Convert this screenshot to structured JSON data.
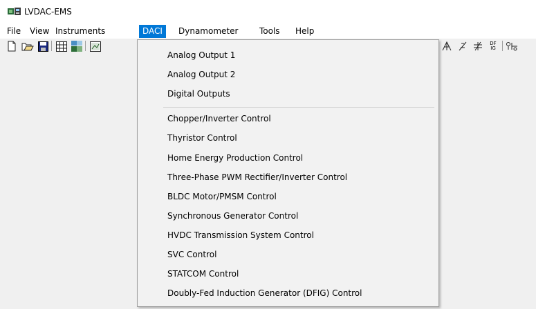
{
  "window": {
    "title": "LVDAC-EMS"
  },
  "menubar": {
    "items": [
      {
        "label": "File"
      },
      {
        "label": "View"
      },
      {
        "label": "Instruments"
      },
      {
        "label": "DACI"
      },
      {
        "label": "Dynamometer"
      },
      {
        "label": "Tools"
      },
      {
        "label": "Help"
      }
    ]
  },
  "toolbar": {
    "icons": [
      "new-file-icon",
      "open-folder-icon",
      "save-icon",
      "table-icon",
      "metering-icon",
      "chart-window-icon",
      "phasor-icon",
      "harmonic-icon",
      "transformer-icon",
      "dfig-icon",
      "oscilloscope-icon"
    ],
    "dfig_glyph": "DF IG"
  },
  "daci_menu": {
    "items": [
      {
        "label": "Analog Output 1"
      },
      {
        "label": "Analog Output 2"
      },
      {
        "label": "Digital Outputs"
      },
      {
        "label": "Chopper/Inverter Control"
      },
      {
        "label": "Thyristor Control"
      },
      {
        "label": "Home Energy Production Control"
      },
      {
        "label": "Three-Phase PWM Rectifier/Inverter Control"
      },
      {
        "label": "BLDC Motor/PMSM Control"
      },
      {
        "label": "Synchronous Generator Control"
      },
      {
        "label": "HVDC Transmission System Control"
      },
      {
        "label": "SVC Control"
      },
      {
        "label": "STATCOM Control"
      },
      {
        "label": "Doubly-Fed Induction Generator (DFIG) Control"
      }
    ]
  },
  "colors": {
    "accent": "#0078d7",
    "menu_bg": "#f2f2f2",
    "window_bg": "#f0f0f0"
  }
}
